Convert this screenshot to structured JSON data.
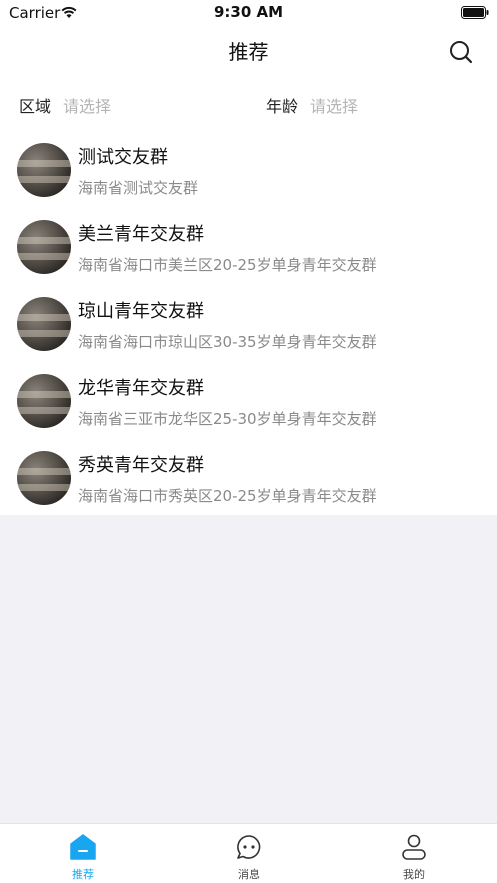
{
  "status_bar": {
    "carrier": "Carrier",
    "time": "9:30 AM"
  },
  "nav": {
    "title": "推荐",
    "search_icon": "search-icon"
  },
  "filters": {
    "region": {
      "label": "区域",
      "placeholder": "请选择"
    },
    "age": {
      "label": "年龄",
      "placeholder": "请选择"
    }
  },
  "groups": [
    {
      "name": "测试交友群",
      "desc": "海南省测试交友群"
    },
    {
      "name": "美兰青年交友群",
      "desc": "海南省海口市美兰区20-25岁单身青年交友群"
    },
    {
      "name": "琼山青年交友群",
      "desc": "海南省海口市琼山区30-35岁单身青年交友群"
    },
    {
      "name": "龙华青年交友群",
      "desc": "海南省三亚市龙华区25-30岁单身青年交友群"
    },
    {
      "name": "秀英青年交友群",
      "desc": "海南省海口市秀英区20-25岁单身青年交友群"
    }
  ],
  "tab_bar": {
    "tabs": [
      {
        "label": "推荐",
        "icon": "home-icon",
        "active": true
      },
      {
        "label": "消息",
        "icon": "message-icon",
        "active": false
      },
      {
        "label": "我的",
        "icon": "profile-icon",
        "active": false
      }
    ]
  },
  "colors": {
    "accent": "#1aa5f0",
    "background": "#f2f2f6"
  }
}
